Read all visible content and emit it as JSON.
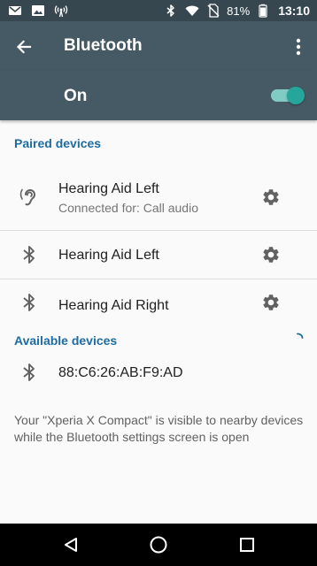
{
  "status_bar": {
    "battery": "81%",
    "time": "13:10",
    "icons": [
      "gmail-icon",
      "image-icon",
      "hotspot-icon",
      "bluetooth-icon",
      "wifi-icon",
      "no-sim-icon",
      "battery-icon"
    ]
  },
  "app_bar": {
    "title": "Bluetooth",
    "back_icon": "arrow-back-icon",
    "overflow_icon": "more-vert-icon"
  },
  "toggle": {
    "label": "On",
    "checked": true
  },
  "paired": {
    "header": "Paired devices",
    "devices": [
      {
        "name": "Hearing Aid Left",
        "subtitle": "Connected for: Call audio",
        "icon": "hearing-icon"
      },
      {
        "name": "Hearing Aid Left",
        "icon": "bluetooth-icon"
      },
      {
        "name": "Hearing Aid Right",
        "icon": "bluetooth-icon"
      }
    ]
  },
  "available": {
    "header": "Available devices",
    "devices": [
      {
        "name": "88:C6:26:AB:F9:AD",
        "icon": "bluetooth-icon"
      }
    ]
  },
  "footer": {
    "text": "Your \"Xperia X Compact\" is visible to nearby devices while the Bluetooth settings screen is open"
  },
  "colors": {
    "app_bar": "#455a64",
    "status_bar": "#37474f",
    "accent": "#26a69a",
    "section_header": "#1e6ba0"
  }
}
